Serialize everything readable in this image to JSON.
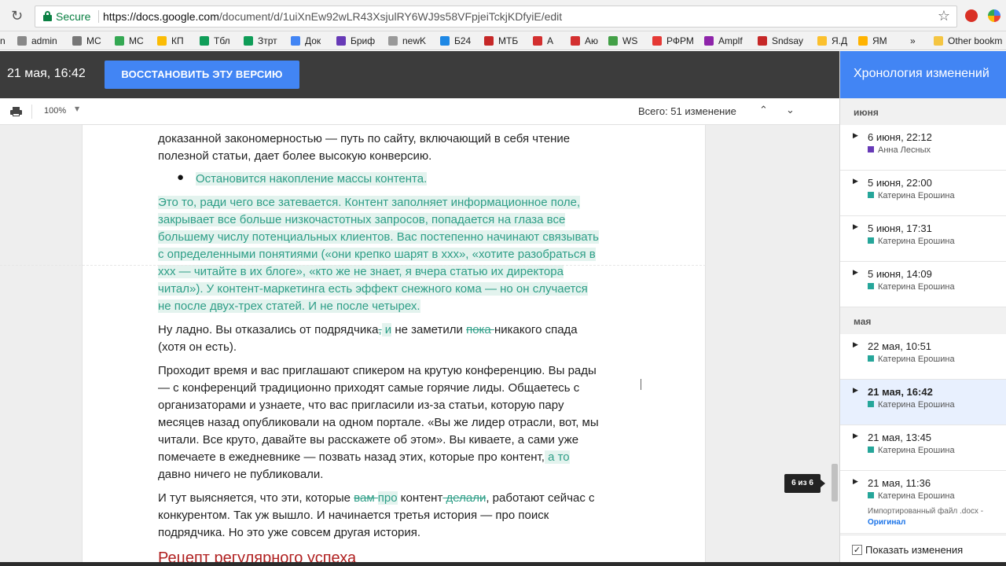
{
  "browser": {
    "secure_label": "Secure",
    "url_host": "https://docs.google.com",
    "url_path": "/document/d/1uiXnEw92wLR43XsjulRY6WJ9s58VFpjeiTckjKDfyiE/edit",
    "star_icon": "star-icon",
    "reload_icon": "reload-icon"
  },
  "bookmarks": [
    {
      "label": "n",
      "color": "#555555"
    },
    {
      "label": "admin",
      "color": "#888888"
    },
    {
      "label": "МС",
      "color": "#777777"
    },
    {
      "label": "МС",
      "color": "#34a853"
    },
    {
      "label": "КП",
      "color": "#fbbc05"
    },
    {
      "label": "Тбл",
      "color": "#0f9d58"
    },
    {
      "label": "Зтрт",
      "color": "#0f9d58"
    },
    {
      "label": "Док",
      "color": "#4285f4"
    },
    {
      "label": "Бриф",
      "color": "#673ab7"
    },
    {
      "label": "newK",
      "color": "#999999"
    },
    {
      "label": "Б24",
      "color": "#1e88e5"
    },
    {
      "label": "МТБ",
      "color": "#c62828"
    },
    {
      "label": "А",
      "color": "#d32f2f"
    },
    {
      "label": "Аю",
      "color": "#d32f2f"
    },
    {
      "label": "WS",
      "color": "#43a047"
    },
    {
      "label": "РФРМ",
      "color": "#e53935"
    },
    {
      "label": "Amplf",
      "color": "#8e24aa"
    },
    {
      "label": "Sndsay",
      "color": "#c62828"
    },
    {
      "label": "Я.Д",
      "color": "#fbc02d"
    },
    {
      "label": "ЯМ",
      "color": "#ffb300"
    },
    {
      "label": "»",
      "color": "#ffffff"
    },
    {
      "label": "Other bookm",
      "color": "#f4c542"
    }
  ],
  "header": {
    "version_date": "21 мая, 16:42",
    "restore_label": "ВОССТАНОВИТЬ ЭТУ ВЕРСИЮ"
  },
  "subtoolbar": {
    "zoom": "100%",
    "total_changes": "Всего: 51 изменение"
  },
  "document": {
    "p1_line1": "доказанной закономерностью — путь по сайту, включающий в себя чтение",
    "p1_line2": "полезной статьи, дает более высокую конверсию.",
    "bullet": "Остановится накопление массы контента.",
    "p2_lines": [
      "Это то, ради чего все затевается. Контент заполняет информационное поле,",
      "закрывает все больше низкочастотных запросов, попадается на глаза все",
      "большему числу потенциальных клиентов. Вас постепенно начинают связывать",
      "с определенными понятиями («они крепко шарят в ххх», «хотите разобраться в",
      "ххх — читайте в их блоге», «кто же не знает, я вчера статью их директора",
      "читал»). У контент-маркетинга есть эффект снежного кома — но он случается",
      "не после двух-трех статей. И не после четырех."
    ],
    "p3_a": "Ну ладно. Вы отказались от подрядчика",
    "p3_del1": ",",
    "p3_ins1": " и",
    "p3_b": " не заметили ",
    "p3_del2": "пока ",
    "p3_c": "никакого спада",
    "p3_line2": "(хотя он есть).",
    "p4_lines": [
      "Проходит время и вас приглашают спикером на крутую конференцию. Вы рады",
      "— с конференций традиционно приходят самые горячие лиды. Общаетесь с",
      "организаторами и узнаете, что вас пригласили из-за статьи, которую пару",
      "месяцев назад опубликовали на одном портале. «Вы же лидер отрасли, вот, мы",
      "читали. Все круто, давайте вы расскажете об этом». Вы киваете, а сами уже"
    ],
    "p4_line6_a": "помечаете в ежедневнике — позвать назад этих, которые про контент,",
    "p4_line6_ins": " а то",
    "p4_line7": "давно ничего не публиковали.",
    "p5_a": "И тут выясняется, что эти, которые ",
    "p5_del1": "вам ",
    "p5_ins1": "про",
    "p5_b": " контент",
    "p5_del2": " делали",
    "p5_c": ", работают сейчас с",
    "p5_line2": "конкурентом. Так уж вышло. И начинается третья история — про поиск",
    "p5_line3": "подрядчика. Но это уже совсем другая история.",
    "heading_partial": "Рецепт регулярного успеха"
  },
  "page_indicator": "6 из 6",
  "sidebar": {
    "title": "Хронология изменений",
    "month_june": "июня",
    "month_may": "мая",
    "entries": [
      {
        "date": "6 июня, 22:12",
        "author": "Анна Лесных",
        "color": "#673ab7"
      },
      {
        "date": "5 июня, 22:00",
        "author": "Катерина Ерошина",
        "color": "#26a69a"
      },
      {
        "date": "5 июня, 17:31",
        "author": "Катерина Ерошина",
        "color": "#26a69a"
      },
      {
        "date": "5 июня, 14:09",
        "author": "Катерина Ерошина",
        "color": "#26a69a"
      },
      {
        "date": "22 мая, 10:51",
        "author": "Катерина Ерошина",
        "color": "#26a69a"
      },
      {
        "date": "21 мая, 16:42",
        "author": "Катерина Ерошина",
        "color": "#26a69a"
      },
      {
        "date": "21 мая, 13:45",
        "author": "Катерина Ерошина",
        "color": "#26a69a"
      },
      {
        "date": "21 мая, 11:36",
        "author": "Катерина Ерошина",
        "color": "#26a69a",
        "extra": "Импортированный файл .docx -",
        "orig": "Оригинал"
      }
    ],
    "show_changes_label": "Показать изменения",
    "show_changes_checked": true
  }
}
